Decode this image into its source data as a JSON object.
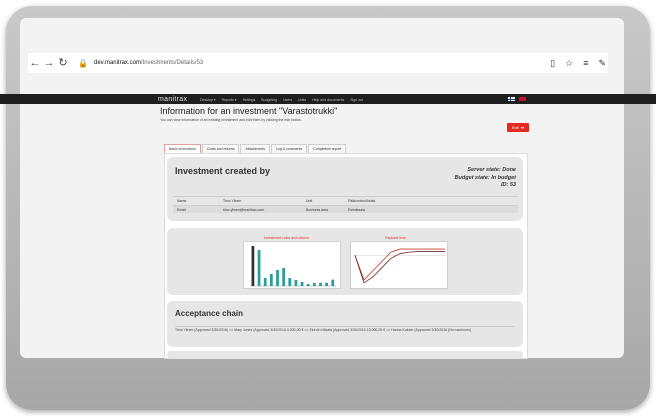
{
  "browser": {
    "url_domain": "dev.manitrax.com",
    "url_path": "/Investments/Details/53",
    "icons": [
      "back-arrow-icon",
      "forward-arrow-icon",
      "refresh-icon",
      "lock-icon",
      "reader-icon",
      "favorite-star-icon",
      "hub-icon",
      "notes-icon"
    ]
  },
  "app": {
    "brand": "manitrax",
    "menu": [
      "Desktop ▾",
      "Reports ▾",
      "Settings",
      "Budgeting",
      "Users",
      "Units",
      "Help and documents",
      "Sign out"
    ]
  },
  "header": {
    "title": "Information for an investment \"Varastotrukki\"",
    "subtitle": "You can view information of an existing investment and edit them by clicking the edit button.",
    "edit_label": "Edit"
  },
  "tabs": [
    "Basic information",
    "Costs and returns",
    "Attachments",
    "Log & comments",
    "Completion report"
  ],
  "investment": {
    "title": "Investment created by",
    "server_state": "Server state: Done",
    "budget_state": "Budget state: In budget",
    "id": "ID: 53",
    "rows": [
      {
        "label": "Name",
        "value": "Timo Ylinen",
        "label2": "Unit",
        "value2": "Pääkonttori/Asiak."
      },
      {
        "label": "Email",
        "value": "timo.ylinen@manitrax.com",
        "label2": "Business area",
        "value2": "Esimiesala"
      }
    ]
  },
  "charts": {
    "costs_title": "Investment costs and returns",
    "payback_title": "Payback time"
  },
  "chart_data": [
    {
      "type": "bar",
      "title": "Investment costs and returns",
      "categories": [
        "1",
        "2",
        "3",
        "4",
        "5",
        "6",
        "7",
        "8",
        "9",
        "10",
        "11",
        "12",
        "13",
        "14"
      ],
      "series": [
        {
          "values": [
            10,
            0,
            0,
            0,
            0,
            0,
            0,
            0,
            0,
            0,
            0,
            0,
            0,
            0
          ]
        },
        {
          "values": [
            0,
            9,
            2,
            3,
            4,
            4.5,
            2,
            1.5,
            1,
            0.5,
            0.8,
            0.8,
            0.8,
            1.6
          ]
        }
      ],
      "ylim": [
        0,
        10
      ]
    },
    {
      "type": "line",
      "title": "Payback time",
      "x": [
        0,
        1,
        2,
        3,
        4,
        5,
        6,
        7,
        8,
        9,
        10
      ],
      "series": [
        {
          "values": [
            0,
            -8,
            -5,
            -2,
            1,
            2,
            2,
            2,
            2,
            2,
            2
          ]
        },
        {
          "values": [
            0,
            -9,
            -7,
            -4,
            -1,
            0.5,
            1,
            1.2,
            1.2,
            1.2,
            1.2
          ]
        }
      ],
      "ylim": [
        -10,
        3
      ]
    }
  ],
  "acceptance": {
    "title": "Acceptance chain",
    "text": "Timo Ylinen (Approved 3/30/2016) => Mary Jones (Approved 3/30/2016 0.000,00 € => Einhörn Maala (Approved 3/30/2016 10.000,00 € => Hanna Kuinen (Approved 3/30/2016 (No maximum)"
  },
  "colors": {
    "accent": "#e22a22",
    "navbar": "#1e1e1e",
    "bar_dark": "#333333",
    "bar_teal": "#2a9d9a",
    "line_red": "#c0392b"
  }
}
